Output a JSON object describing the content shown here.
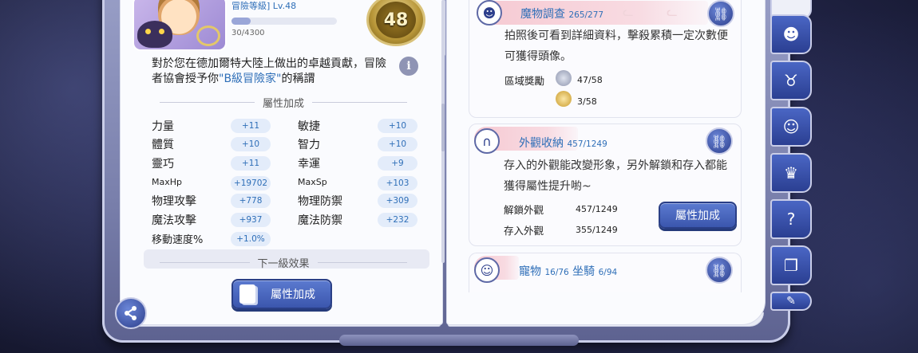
{
  "profile": {
    "level_title": "冒險等級] Lv.48",
    "exp_text": "30/4300",
    "exp_fraction": 0.06,
    "medal_level": "48"
  },
  "description": {
    "text_before": "對於您在德加爾特大陸上做出的卓越貢獻，冒險者協會授予你",
    "highlight": "\"B級冒險家\"",
    "text_after": "的稱謂"
  },
  "attributes": {
    "heading": "屬性加成",
    "stats": [
      {
        "label": "力量",
        "value": "+11"
      },
      {
        "label": "敏捷",
        "value": "+10"
      },
      {
        "label": "體質",
        "value": "+10"
      },
      {
        "label": "智力",
        "value": "+10"
      },
      {
        "label": "靈巧",
        "value": "+11"
      },
      {
        "label": "幸運",
        "value": "+9"
      },
      {
        "label": "MaxHp",
        "value": "+19702"
      },
      {
        "label": "MaxSp",
        "value": "+103"
      },
      {
        "label": "物理攻擊",
        "value": "+778"
      },
      {
        "label": "物理防禦",
        "value": "+309"
      },
      {
        "label": "魔法攻擊",
        "value": "+937"
      },
      {
        "label": "魔法防禦",
        "value": "+232"
      },
      {
        "label": "移動速度%",
        "value": "+1.0%"
      }
    ],
    "next_level_heading": "下一級效果"
  },
  "left_button": {
    "label": "屬性加成"
  },
  "monster_card": {
    "title": "魔物調查",
    "count": "265/277",
    "text": "拍照後可看到詳細資料，擊殺累積一定次數便可獲得頭像。",
    "reward_label": "區域獎勵",
    "reward1": "47/58",
    "reward2": "3/58",
    "tab_color": "#f6c9d2"
  },
  "appearance_card": {
    "title": "外觀收納",
    "count": "457/1249",
    "text": "存入的外觀能改變形象，另外解鎖和存入都能獲得屬性提升喲~",
    "unlock_label": "解鎖外觀",
    "unlock_value": "457/1249",
    "stored_label": "存入外觀",
    "stored_value": "355/1249",
    "button_label": "屬性加成"
  },
  "pet_card": {
    "title": "寵物",
    "pet_count": "16/76",
    "mount_label": "坐騎",
    "mount_count": "6/94"
  },
  "side_tabs": [
    "cat-face-icon",
    "horns-icon",
    "pet-face-icon",
    "chef-hat-icon",
    "head-question-icon",
    "open-book-icon",
    "badge-icon"
  ],
  "colors": {
    "accent_blue": "#2f6fb8",
    "button_blue": "#3b56ad",
    "pink_tab": "#f6c9d2"
  }
}
